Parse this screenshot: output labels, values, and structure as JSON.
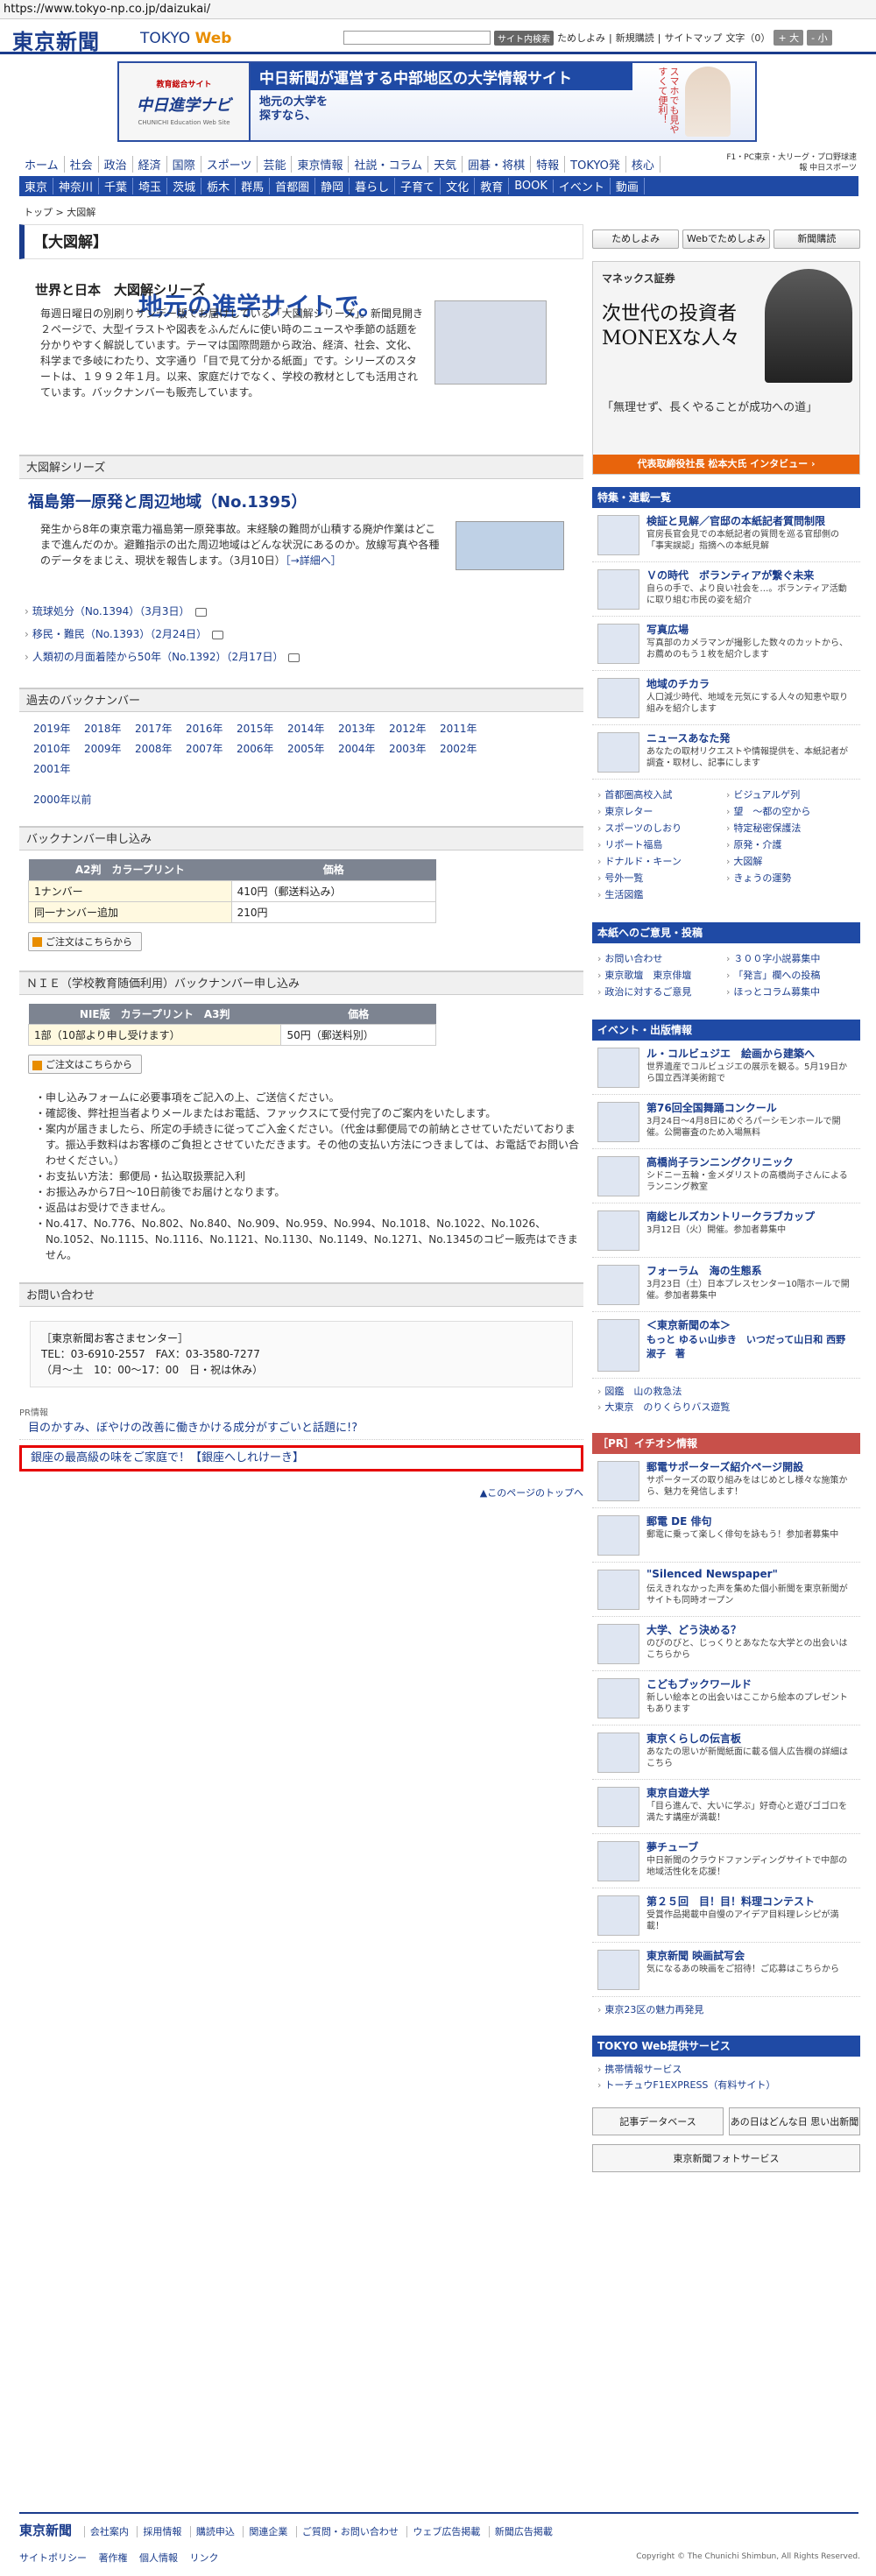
{
  "browser": {
    "url": "https://www.tokyo-np.co.jp/daizukai/"
  },
  "header": {
    "logo": "東京新聞",
    "logo_web_1": "TOKYO",
    "logo_web_2": "Web",
    "search_btn": "サイト内検索",
    "link1": "ためしよみ",
    "link2": "新規購読",
    "link3": "サイトマップ",
    "fontsize_label": "文字（0）",
    "fs_plus": "+ 大",
    "fs_minus": "- 小"
  },
  "banner": {
    "badge": "教育総合サイト",
    "logo": "中日進学ナビ",
    "logo_en": "CHUNICHI Education Web Site",
    "top": "中日新聞が運営する中部地区の大学情報サイト",
    "sub": "地元の大学を探すなら、",
    "main": "地元の進学サイトで。",
    "side": "スマホでも見やすくて便利！"
  },
  "nav1": [
    "ホーム",
    "社会",
    "政治",
    "経済",
    "国際",
    "スポーツ",
    "芸能",
    "東京情報",
    "社説・コラム",
    "天気",
    "囲碁・将棋",
    "特報",
    "TOKYO発",
    "核心"
  ],
  "nav_sponsor": "F1・PC東京・大リーグ・プロ野球速報 中日スポーツ",
  "nav2": [
    "東京",
    "神奈川",
    "千葉",
    "埼玉",
    "茨城",
    "栃木",
    "群馬",
    "首都圏",
    "静岡",
    "暮らし",
    "子育て",
    "文化",
    "教育",
    "BOOK",
    "イベント",
    "動画"
  ],
  "breadcrumb": "トップ > 大図解",
  "main": {
    "title": "【大図解】",
    "intro_heading": "世界と日本　大図解シリーズ",
    "intro_text": "毎週日曜日の別刷りサンデー版でお届けしている「大図解シリーズ」。新聞見開き２ページで、大型イラストや図表をふんだんに使い時のニュースや季節の話題を分かりやすく解説しています。テーマは国際問題から政治、経済、社会、文化、科学まで多岐にわたり、文字通り「目で見て分かる紙面」です。シリーズのスタートは、１９９２年１月。以来、家庭だけでなく、学校の教材としても活用されています。バックナンバーも販売しています。",
    "series_box": "大図解シリーズ",
    "article_title": "福島第一原発と周辺地域（No.1395）",
    "article_text": "発生から8年の東京電力福島第一原発事故。末経験の難問が山積する廃炉作業はどこまで進んだのか。避難指示の出た周辺地域はどんな状況にあるのか。放線写真や各種のデータをまじえ、現状を報告します。（3月10日）",
    "more_link": "［→詳細へ］",
    "past_items": [
      "琉球処分（No.1394）（3月3日）",
      "移民・難民（No.1393）（2月24日）",
      "人類初の月面着陸から50年（No.1392）（2月17日）"
    ],
    "backnumber_box": "過去のバックナンバー",
    "years": [
      "2019年",
      "2018年",
      "2017年",
      "2016年",
      "2015年",
      "2014年",
      "2013年",
      "2012年",
      "2011年",
      "2010年",
      "2009年",
      "2008年",
      "2007年",
      "2006年",
      "2005年",
      "2004年",
      "2003年",
      "2002年",
      "2001年"
    ],
    "year_older": "2000年以前",
    "order_box": "バックナンバー申し込み",
    "price_headers": [
      "A2判　カラープリント",
      "価格"
    ],
    "price_rows": [
      [
        "1ナンバー",
        "410円（郵送料込み）"
      ],
      [
        "同一ナンバー追加",
        "210円"
      ]
    ],
    "order_btn": "ご注文はこちらから",
    "nie_box": "ＮＩＥ（学校教育随価利用）バックナンバー申し込み",
    "nie_headers": [
      "NIE版　カラープリント　A3判",
      "価格"
    ],
    "nie_rows": [
      [
        "1部（10部より申し受けます）",
        "50円（郵送料別）"
      ]
    ],
    "nie_btn": "ご注文はこちらから",
    "notes": [
      "申し込みフォームに必要事項をご記入の上、ご送信ください。",
      "確認後、弊社担当者よりメールまたはお電話、ファックスにて受付完了のご案内をいたします。",
      "案内が届きましたら、所定の手続きに従ってご入金ください。（代金は郵便局での前納とさせていただいております。振込手数料はお客様のご負担とさせていただきます。その他の支払い方法につきましては、お電話でお問い合わせください。）",
      "お支払い方法：郵便局・払込取扱票記入利",
      "お振込みから7日〜10日前後でお届けとなります。",
      "返品はお受けできません。",
      "No.417、No.776、No.802、No.840、No.909、No.959、No.994、No.1018、No.1022、No.1026、No.1052、No.1115、No.1116、No.1121、No.1130、No.1149、No.1271、No.1345のコピー販売はできません。"
    ],
    "contact_box": "お問い合わせ",
    "contact_name": "［東京新聞お客さまセンター］",
    "contact_tel": "TEL：03-6910-2557　FAX：03-3580-7277",
    "contact_hours": "（月〜土　10：00〜17：00　日・祝は休み）",
    "pr_label": "PR情報",
    "pr1": "目のかすみ、ぼやけの改善に働きかける成分がすごいと話題に!?",
    "pr2": "銀座の最高級の味をご家庭で！【銀座へしれけーき】",
    "to_top": "▲このページのトップへ"
  },
  "side": {
    "tabs": [
      "ためしよみ",
      "Webでためしよみ",
      "新聞購読"
    ],
    "ad_brand": "マネックス証券",
    "ad_h1": "次世代の投資者MONEXな人々",
    "ad_h2": "「無理せず、長くやることが成功への道」",
    "ad_bar": "代表取締役社長 松本大氏 インタビュー ›",
    "feature_head": "特集・連載一覧",
    "features": [
      {
        "t": "検証と見解／官邸の本紙記者質問制限",
        "d": "官房長官会見での本紙記者の質問を巡る官邸側の「事実誤認」指摘への本紙見解"
      },
      {
        "t": "Ｖの時代　ボランティアが繋ぐ未来",
        "d": "自らの手で、より良い社会を…。ボランティア活動に取り組む市民の姿を紹介"
      },
      {
        "t": "写真広場",
        "d": "写真部のカメラマンが撮影した数々のカットから、お薦めのもう１枚を紹介します"
      },
      {
        "t": "地域のチカラ",
        "d": "人口減少時代、地域を元気にする人々の知恵や取り組みを紹介します"
      },
      {
        "t": "ニュースあなた発",
        "d": "あなたの取材リクエストや情報提供を、本紙記者が調査・取材し、記事にします"
      }
    ],
    "feature_links": [
      "首都圏高校入試",
      "ビジュアルゲ列",
      "東京レター",
      "望　～都の空から",
      "スポーツのしおり",
      "特定秘密保護法",
      "リポート福島",
      "原発・介護",
      "ドナルド・キーン",
      "大図解",
      "号外一覧",
      "きょうの運勢",
      "生活図鑑"
    ],
    "reader_head": "本紙へのご意見・投稿",
    "reader_links": [
      "お問い合わせ",
      "３００字小説募集中",
      "東京歌壇　東京俳壇",
      "「発言」欄への投稿",
      "政治に対するご意見",
      "ほっとコラム募集中"
    ],
    "event_head": "イベント・出版情報",
    "events": [
      {
        "t": "ル・コルビュジエ　絵画から建築へ",
        "d": "世界遺産でコルビュジエの展示を観る。5月19日から国立西洋美術館で"
      },
      {
        "t": "第76回全国舞踊コンクール",
        "d": "3月24日〜4月8日にめぐろパーシモンホールで開催。公開審査のため入場無料"
      },
      {
        "t": "高橋尚子ランニングクリニック",
        "d": "シドニー五輪・金メダリストの高橋尚子さんによるランニング教室"
      },
      {
        "t": "南総ヒルズカントリークラブカップ",
        "d": "3月12日（火）開催。参加者募集中"
      },
      {
        "t": "フォーラム　海の生態系",
        "d": "3月23日（土）日本プレスセンター10階ホールで開催。参加者募集中"
      },
      {
        "t": "＜東京新聞の本＞",
        "d": "もっと ゆるぃ山歩き　いつだって山日和 西野淑子　著"
      }
    ],
    "event_links": [
      "図鑑　山の救急法",
      "大東京　のりくらりバス遊覧"
    ],
    "pr_head": "［PR］イチオシ情報",
    "prs": [
      {
        "t": "郵電サポーターズ紹介ページ開設",
        "d": "サポーターズの取り組みをはじめとし様々な施策から、魅力を発信します！"
      },
      {
        "t": "郵電 DE 俳句",
        "d": "郵電に乗って楽しく俳句を詠もう！参加者募集中"
      },
      {
        "t": "\"Silenced Newspaper\"",
        "d": "伝えきれなかった声を集めた個小新聞を東京新聞がサイトも同時オープン"
      },
      {
        "t": "大学、どう決める？",
        "d": "のびのびと、じっくりとあなたな大学との出会いはこちらから"
      },
      {
        "t": "こどもブックワールド",
        "d": "新しい絵本との出会いはここから絵本のプレゼントもあります"
      },
      {
        "t": "東京くらしの伝言板",
        "d": "あなたの思いが新聞紙面に載る個人広告欄の詳細はこちら"
      },
      {
        "t": "東京自遊大学",
        "d": "「目ら進んで、大いに学ぶ」好奇心と遊びゴゴロを満たす講座が満載！"
      },
      {
        "t": "夢チューブ",
        "d": "中日新聞のクラウドファンディングサイトで中部の地域活性化を応援！"
      },
      {
        "t": "第２５回　目！目！料理コンテスト",
        "d": "受賞作品掲載中自慢のアイデア目料理レシピが満載！"
      },
      {
        "t": "東京新聞 映画試写会",
        "d": "気になるあの映画をご招待！ご応募はこちらから"
      }
    ],
    "pr_link": "東京23区の魅力再発見",
    "web_head": "TOKYO Web提供サービス",
    "web_links": [
      "携帯情報サービス",
      "トーチュウF1EXPRESS（有料サイト）"
    ],
    "btn1": "記事データベース",
    "btn2": "あの日はどんな日 思い出新聞",
    "btn3": "東京新聞フォトサービス"
  },
  "footer": {
    "logo": "東京新聞",
    "links": [
      "会社案内",
      "採用情報",
      "購読申込",
      "関連企業",
      "ご質問・お問い合わせ",
      "ウェブ広告掲載",
      "新聞広告掲載"
    ],
    "links2": [
      "サイトポリシー",
      "著作権",
      "個人情報",
      "リンク"
    ],
    "copyright": "Copyright © The Chunichi Shimbun, All Rights Reserved."
  }
}
